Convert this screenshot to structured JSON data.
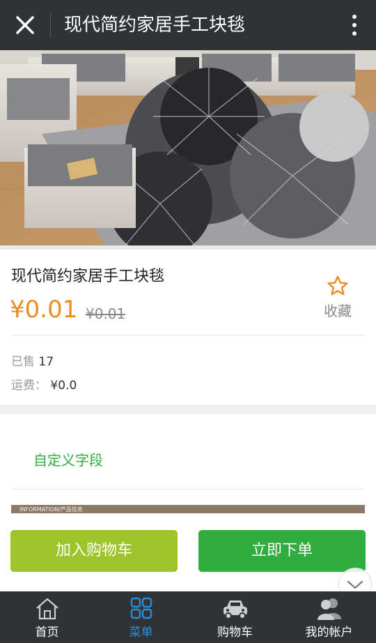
{
  "header": {
    "title": "现代简约家居手工块毯"
  },
  "carousel": {
    "active_index": 2,
    "count": 4
  },
  "product": {
    "name": "现代简约家居手工块毯",
    "price": "¥0.01",
    "original_price": "¥0.01",
    "favorite_label": "收藏",
    "sold_label": "已售",
    "sold_count": "17",
    "shipping_label": "运费：",
    "shipping_value": "¥0.0"
  },
  "custom_field": {
    "label": "自定义字段"
  },
  "info_strip": {
    "text": "INFORMATION/产品信息"
  },
  "actions": {
    "add_to_cart": "加入购物车",
    "buy_now": "立即下单"
  },
  "tabbar": {
    "items": [
      {
        "label": "首页",
        "icon": "home-icon"
      },
      {
        "label": "菜单",
        "icon": "menu-grid-icon"
      },
      {
        "label": "购物车",
        "icon": "car-icon"
      },
      {
        "label": "我的帐户",
        "icon": "users-icon"
      }
    ],
    "active_index": 1
  },
  "colors": {
    "topbar": "#2f3336",
    "price": "#f08a1c",
    "green": "#30ad3e",
    "lime": "#9dc52b",
    "tab_active": "#2a8fd8"
  }
}
